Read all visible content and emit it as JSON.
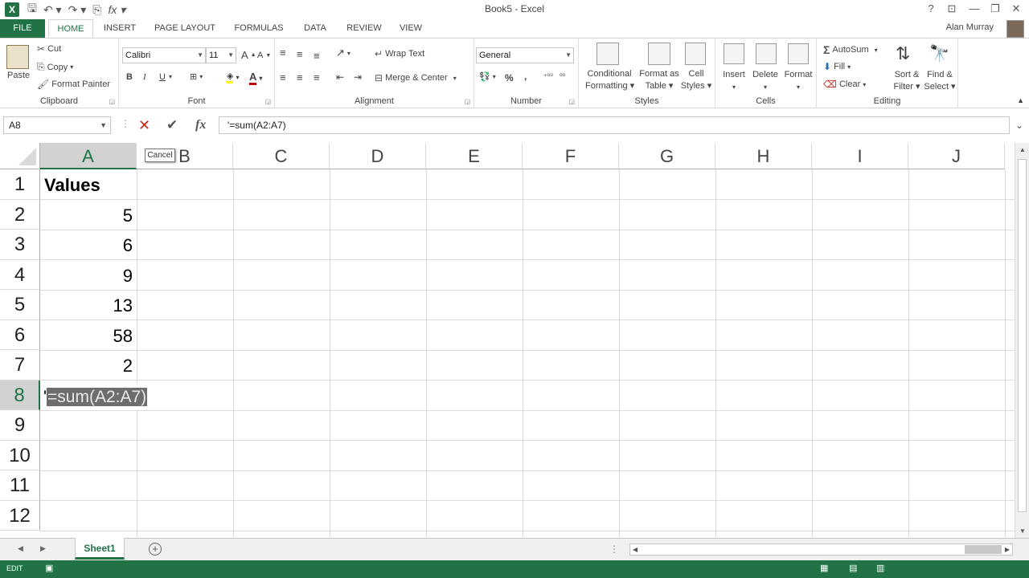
{
  "app": {
    "title": "Book5 - Excel",
    "user": "Alan Murray"
  },
  "qat": {
    "save_icon": "save-icon",
    "undo_icon": "undo-icon",
    "redo_icon": "redo-icon"
  },
  "tabs": [
    "FILE",
    "HOME",
    "INSERT",
    "PAGE LAYOUT",
    "FORMULAS",
    "DATA",
    "REVIEW",
    "VIEW"
  ],
  "ribbon": {
    "clipboard": {
      "label": "Clipboard",
      "paste": "Paste",
      "cut": "Cut",
      "copy": "Copy",
      "format_painter": "Format Painter"
    },
    "font": {
      "label": "Font",
      "name": "Calibri",
      "size": "11",
      "bold": "B",
      "italic": "I",
      "underline": "U"
    },
    "alignment": {
      "label": "Alignment",
      "wrap_text": "Wrap Text",
      "merge_center": "Merge & Center"
    },
    "number": {
      "label": "Number",
      "format": "General"
    },
    "styles": {
      "label": "Styles",
      "conditional": "Conditional",
      "formatting": "Formatting",
      "format_as": "Format as",
      "table": "Table",
      "cell": "Cell",
      "cell_styles": "Styles"
    },
    "cells": {
      "label": "Cells",
      "insert": "Insert",
      "delete": "Delete",
      "format": "Format"
    },
    "editing": {
      "label": "Editing",
      "autosum": "AutoSum",
      "fill": "Fill",
      "clear": "Clear",
      "sort1": "Sort &",
      "sort2": "Filter",
      "find1": "Find &",
      "find2": "Select"
    }
  },
  "formula_bar": {
    "name_box": "A8",
    "formula": "'=sum(A2:A7)",
    "tooltip": "Cancel"
  },
  "grid": {
    "columns": [
      "A",
      "B",
      "C",
      "D",
      "E",
      "F",
      "G",
      "H",
      "I",
      "J"
    ],
    "rows": [
      "1",
      "2",
      "3",
      "4",
      "5",
      "6",
      "7",
      "8",
      "9",
      "10",
      "11",
      "12"
    ],
    "header": "Values",
    "values": [
      "5",
      "6",
      "9",
      "13",
      "58",
      "2"
    ],
    "edit_apostrophe": "'",
    "edit_text": "=sum(A2:A7)"
  },
  "sheets": {
    "active": "Sheet1"
  },
  "status": {
    "mode": "EDIT"
  },
  "colors": {
    "excel_green": "#217346",
    "cancel_red": "#c42b1c"
  }
}
